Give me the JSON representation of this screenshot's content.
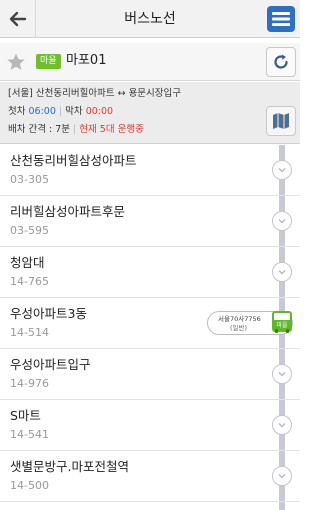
{
  "header": {
    "title": "버스노선"
  },
  "route": {
    "badge": "마을",
    "number": "마포01"
  },
  "info": {
    "direction": "[서울] 산천동리버힐아파트 ↔ 용문시장입구",
    "first_label": "첫차",
    "first_time": "06:00",
    "last_label": "막차",
    "last_time": "00:00",
    "interval": "배차 간격 : 7분",
    "running": "현재 5대 운행중"
  },
  "stops": [
    {
      "name": "산천동리버힐삼성아파트",
      "code": "03-305"
    },
    {
      "name": "리버힐삼성아파트후문",
      "code": "03-595"
    },
    {
      "name": "청암대",
      "code": "14-765"
    },
    {
      "name": "우성아파트3동",
      "code": "14-514"
    },
    {
      "name": "우성아파트입구",
      "code": "14-976"
    },
    {
      "name": "S마트",
      "code": "14-541"
    },
    {
      "name": "샛별문방구.마포전철역",
      "code": "14-500"
    }
  ],
  "bus": {
    "plate": "서울70사7756",
    "type": "(일반)",
    "badge": "마을"
  },
  "colors": {
    "accent_blue": "#1f6fd6",
    "red": "#e23b2f",
    "maeul_green": "#6fbe2c",
    "menu_blue": "#2d6fc4"
  },
  "icons": [
    "back-arrow-icon",
    "menu-icon",
    "star-icon",
    "refresh-icon",
    "map-icon",
    "chevron-down-icon",
    "bus-icon"
  ]
}
